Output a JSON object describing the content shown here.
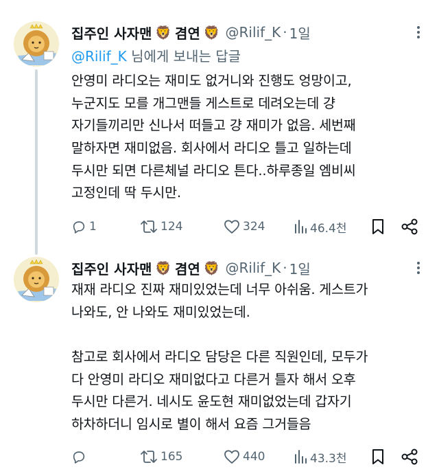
{
  "tweets": [
    {
      "author": {
        "name_prefix": "집주인 사자맨",
        "name_mid": "겸연",
        "emoji": "🦁",
        "handle": "@Rilif_K",
        "separator": "·",
        "time": "1일"
      },
      "reply_to": {
        "mention": "@Rilif_K",
        "suffix": " 님에게 보내는 답글"
      },
      "lines": [
        "안영미 라디오는 재미도 없거니와 진행도 엉망이고,",
        "누군지도 모를 개그맨들 게스트로 데려오는데 걍",
        "자기들끼리만 신나서 떠들고 걍 재미가 없음. 세번째",
        "말하자면 재미없음. 회사에서 라디오 틀고 일하는데",
        "두시만 되면 다른체널 라디오 튼다..하루종일 엠비씨",
        "고정인데 딱 두시만."
      ],
      "stats": {
        "replies": "1",
        "retweets": "124",
        "likes": "324",
        "views": "46.4천"
      }
    },
    {
      "author": {
        "name_prefix": "집주인 사자맨",
        "name_mid": "겸연",
        "emoji": "🦁",
        "handle": "@Rilif_K",
        "separator": "·",
        "time": "1일"
      },
      "lines": [
        "재재 라디오 진짜 재미있었는데 너무 아쉬움. 게스트가",
        "나와도, 안 나와도 재미있었는데.",
        "",
        "참고로 회사에서 라디오 담당은 다른 직원인데, 모두가",
        "다 안영미 라디오 재미없다고 다른거 틀자 해서 오후",
        "두시만 다른거. 네시도 윤도현 재미없었는데 갑자기",
        "하차하더니 임시로 별이 해서 요즘 그거들음"
      ],
      "stats": {
        "replies": "",
        "retweets": "165",
        "likes": "440",
        "views": "43.3천"
      }
    }
  ],
  "colors": {
    "text": "#0f1419",
    "secondary": "#536471",
    "link": "#1d9bf0",
    "thread_line": "#cfd9de"
  },
  "icons": [
    "reply-icon",
    "retweet-icon",
    "like-icon",
    "views-icon",
    "bookmark-icon",
    "share-icon",
    "more-icon"
  ]
}
